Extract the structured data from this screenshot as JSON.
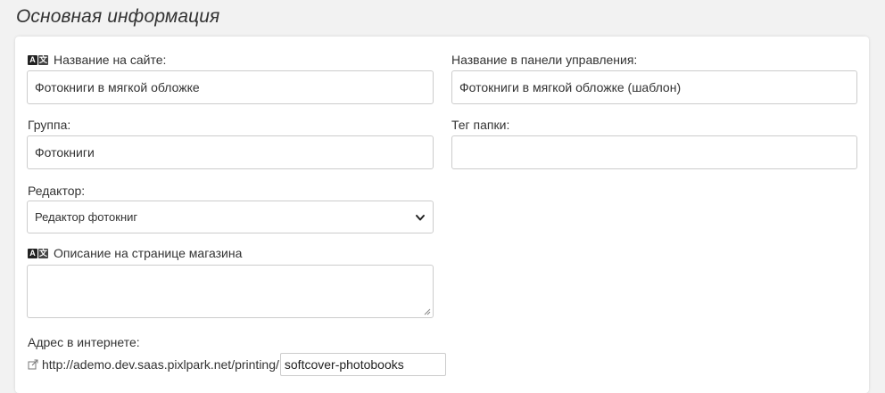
{
  "section": {
    "title": "Основная информация"
  },
  "form": {
    "site_name": {
      "label": "Название на сайте:",
      "value": "Фотокниги в мягкой обложке"
    },
    "admin_name": {
      "label": "Название в панели управления:",
      "value": "Фотокниги в мягкой обложке (шаблон)"
    },
    "group": {
      "label": "Группа:",
      "value": "Фотокниги"
    },
    "folder_tag": {
      "label": "Тег папки:",
      "value": ""
    },
    "editor": {
      "label": "Редактор:",
      "selected": "Редактор фотокниг"
    },
    "shop_description": {
      "label": "Описание на странице магазина",
      "value": ""
    },
    "web_address": {
      "label": "Адрес в интернете:",
      "prefix": "http://ademo.dev.saas.pixlpark.net/printing/",
      "slug": "softcover-photobooks"
    }
  },
  "icons": {
    "translate": "translate-icon",
    "external_link": "external-link-icon",
    "chevron": "chevron-down-icon"
  }
}
